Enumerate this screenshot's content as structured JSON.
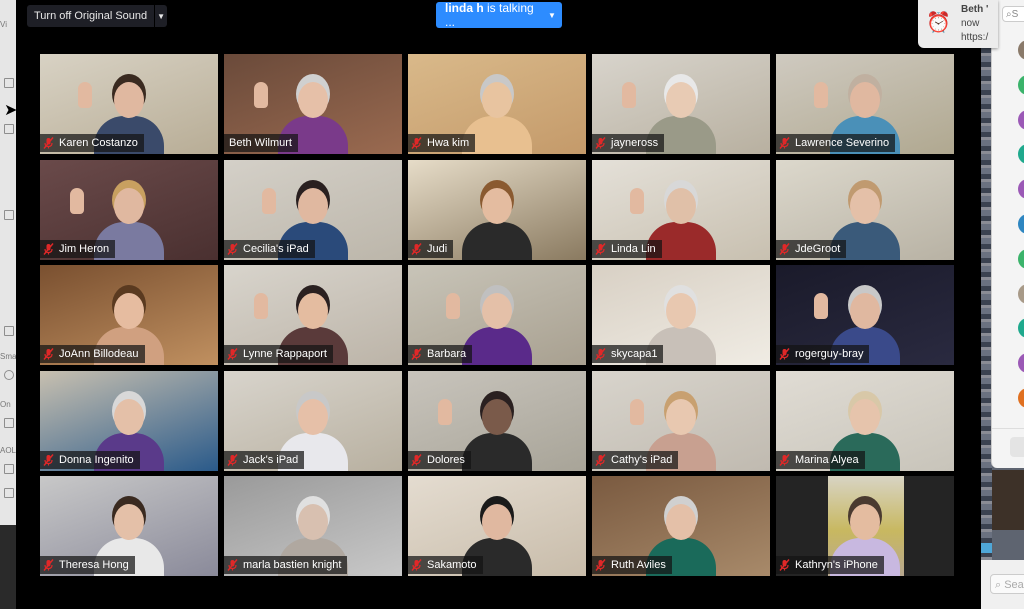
{
  "app": "Zoom Meeting - Gallery View",
  "toolbar": {
    "original_sound_label": "Turn off Original Sound",
    "original_sound_dropdown": "chevron-down",
    "talking_indicator": {
      "speaker": "linda h",
      "suffix": " is talking ...",
      "color": "#2d8cff"
    }
  },
  "notification": {
    "icon": "alarm-clock",
    "title": "Beth '",
    "line2": "now",
    "line3": "https:/"
  },
  "participants": [
    {
      "name": "Karen Costanzo",
      "muted": true
    },
    {
      "name": "Beth Wilmurt",
      "muted": false
    },
    {
      "name": "Hwa kim",
      "muted": true
    },
    {
      "name": "jayneross",
      "muted": true
    },
    {
      "name": "Lawrence Severino",
      "muted": true
    },
    {
      "name": "Jim Heron",
      "muted": true
    },
    {
      "name": "Cecilia's iPad",
      "muted": true
    },
    {
      "name": "Judi",
      "muted": true
    },
    {
      "name": "Linda Lin",
      "muted": true
    },
    {
      "name": "JdeGroot",
      "muted": true
    },
    {
      "name": "JoAnn Billodeau",
      "muted": true
    },
    {
      "name": "Lynne Rappaport",
      "muted": true
    },
    {
      "name": "Barbara",
      "muted": true
    },
    {
      "name": "skycapa1",
      "muted": true
    },
    {
      "name": "rogerguy-bray",
      "muted": true
    },
    {
      "name": "Donna Ingenito",
      "muted": true
    },
    {
      "name": "Jack's iPad",
      "muted": true
    },
    {
      "name": "Dolores",
      "muted": true
    },
    {
      "name": "Cathy's iPad",
      "muted": true
    },
    {
      "name": "Marina Alyea",
      "muted": true
    },
    {
      "name": "Theresa Hong",
      "muted": true
    },
    {
      "name": "marla bastien knight",
      "muted": true
    },
    {
      "name": "Sakamoto",
      "muted": true
    },
    {
      "name": "Ruth Aviles",
      "muted": true
    },
    {
      "name": "Kathryn's iPhone",
      "muted": true
    }
  ],
  "contacts_panel": {
    "search_placeholder": "S",
    "avatar_colors": [
      "#8a7a6a",
      "#3bb36b",
      "#9b59b6",
      "#1fa98d",
      "#9b59b6",
      "#2e86c1",
      "#3bb36b",
      "#a89a88",
      "#1fa98d",
      "#9b59b6",
      "#e07020"
    ]
  },
  "bottom_search": {
    "placeholder": "Sea"
  },
  "left_sidebar": {
    "labels": [
      "Vi",
      "Sma",
      "On",
      "AOL"
    ]
  },
  "colors": {
    "mute_red": "#e02828",
    "accent_blue": "#2d8cff"
  }
}
